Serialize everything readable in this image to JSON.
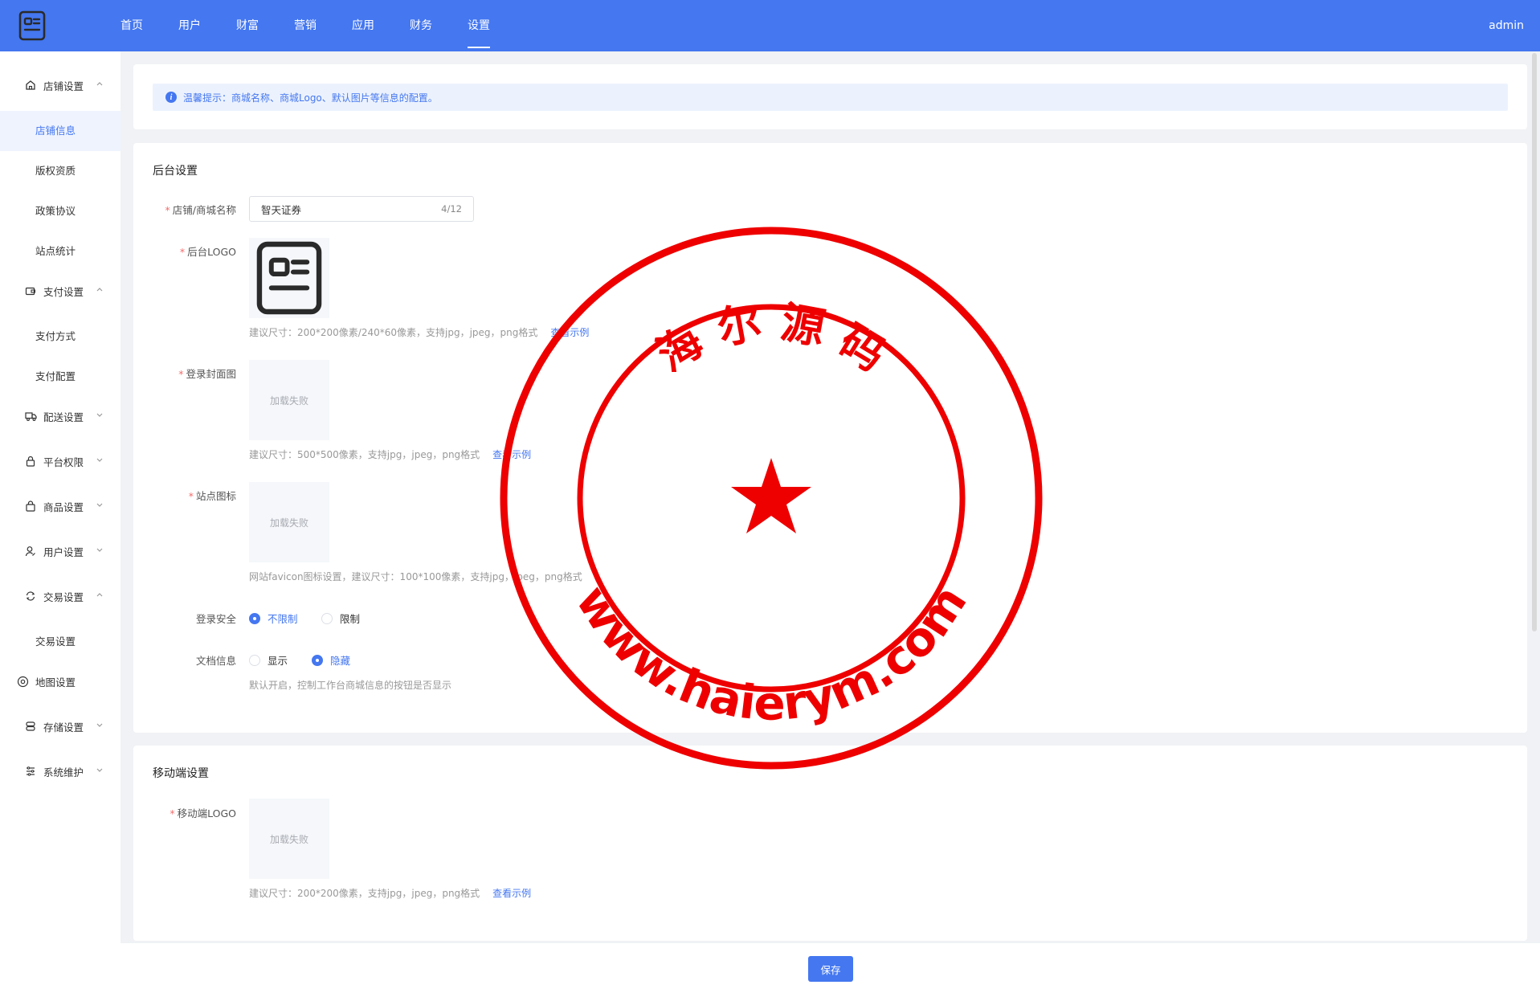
{
  "header": {
    "nav": [
      "首页",
      "用户",
      "财富",
      "营销",
      "应用",
      "财务",
      "设置"
    ],
    "active_nav": "设置",
    "user": "admin",
    "logo_icon": "document-card-icon"
  },
  "sidebar": {
    "groups": [
      {
        "label": "店铺设置",
        "icon": "home-icon",
        "expanded": true
      },
      {
        "label": "支付设置",
        "icon": "wallet-icon",
        "expanded": true
      },
      {
        "label": "配送设置",
        "icon": "truck-icon",
        "expanded": false
      },
      {
        "label": "平台权限",
        "icon": "lock-icon",
        "expanded": false
      },
      {
        "label": "商品设置",
        "icon": "bag-icon",
        "expanded": false
      },
      {
        "label": "用户设置",
        "icon": "user-edit-icon",
        "expanded": false
      },
      {
        "label": "交易设置",
        "icon": "exchange-icon",
        "expanded": true
      },
      {
        "label": "地图设置",
        "icon": "map-target-icon",
        "expanded": false
      },
      {
        "label": "存储设置",
        "icon": "database-icon",
        "expanded": false
      },
      {
        "label": "系统维护",
        "icon": "list-settings-icon",
        "expanded": false
      }
    ],
    "subs": {
      "store": [
        "店铺信息",
        "版权资质",
        "政策协议",
        "站点统计"
      ],
      "pay": [
        "支付方式",
        "支付配置"
      ],
      "trade": [
        "交易设置"
      ]
    }
  },
  "alert": {
    "text": "温馨提示：商城名称、商城Logo、默认图片等信息的配置。"
  },
  "backend": {
    "title": "后台设置",
    "store_name": {
      "label": "店铺/商城名称",
      "value": "智天证券",
      "count": "4/12"
    },
    "logo": {
      "label": "后台LOGO",
      "hint": "建议尺寸：200*200像素/240*60像素，支持jpg，jpeg，png格式",
      "link": "查看示例"
    },
    "login_cover": {
      "label": "登录封面图",
      "placeholder": "加载失败",
      "hint": "建议尺寸：500*500像素，支持jpg，jpeg，png格式",
      "link": "查看示例"
    },
    "favicon": {
      "label": "站点图标",
      "placeholder": "加载失败",
      "hint": "网站favicon图标设置，建议尺寸：100*100像素，支持jpg，jpeg，png格式"
    },
    "login_security": {
      "label": "登录安全",
      "options": [
        "不限制",
        "限制"
      ],
      "selected": "不限制"
    },
    "doc_info": {
      "label": "文档信息",
      "options": [
        "显示",
        "隐藏"
      ],
      "selected": "隐藏",
      "hint": "默认开启，控制工作台商城信息的按钮是否显示"
    }
  },
  "mobile": {
    "title": "移动端设置",
    "logo": {
      "label": "移动端LOGO",
      "placeholder": "加载失败",
      "hint": "建议尺寸：200*200像素，支持jpg，jpeg，png格式",
      "link": "查看示例"
    }
  },
  "footer": {
    "save": "保存"
  },
  "watermark": {
    "top_text": "海 尔 源 码",
    "bottom_text": "www.haierym.com",
    "color": "#ee0000"
  }
}
